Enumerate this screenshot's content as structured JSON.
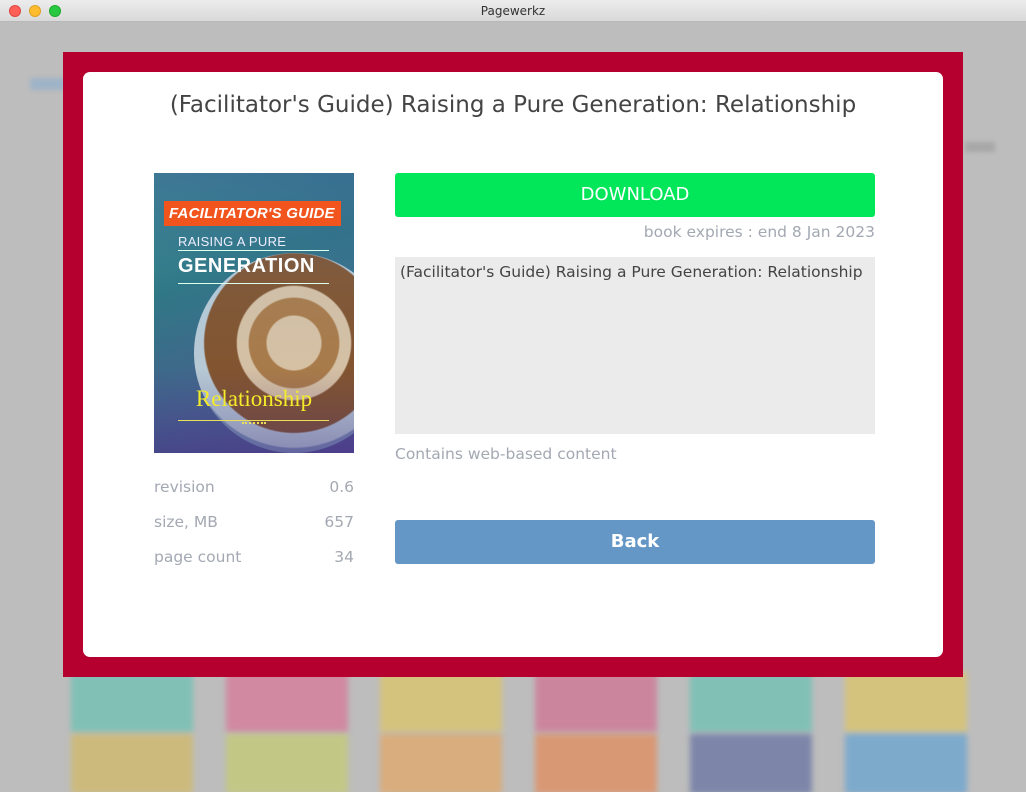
{
  "window": {
    "title": "Pagewerkz"
  },
  "book": {
    "title": "(Facilitator's Guide) Raising a Pure Generation: Relationship",
    "cover": {
      "badge": "FACILITATOR'S GUIDE",
      "line1": "RAISING A PURE",
      "line2": "GENERATION",
      "subtitle": "Relationship"
    },
    "meta": [
      {
        "label": "revision",
        "value": "0.6"
      },
      {
        "label": "size, MB",
        "value": "657"
      },
      {
        "label": "page count",
        "value": "34"
      }
    ],
    "download_label": "DOWNLOAD",
    "expires": "book expires : end 8 Jan 2023",
    "description": "(Facilitator's Guide) Raising a Pure Generation: Relationship",
    "web_note": "Contains web-based content",
    "back_label": "Back"
  },
  "colors": {
    "modal_border": "#b5002f",
    "download": "#02e659",
    "back": "#6497c6"
  },
  "background_cards": [
    {
      "color": "#4fc4b0"
    },
    {
      "color": "#e0608a"
    },
    {
      "color": "#e8c84a"
    },
    {
      "color": "#d85a86"
    },
    {
      "color": "#4fc4b0"
    },
    {
      "color": "#e8c84a"
    },
    {
      "color": "#d9b84a"
    },
    {
      "color": "#c8d05a"
    },
    {
      "color": "#f0a04a"
    },
    {
      "color": "#f07a3a"
    },
    {
      "color": "#4a5a9a"
    },
    {
      "color": "#4a9ad8"
    }
  ]
}
